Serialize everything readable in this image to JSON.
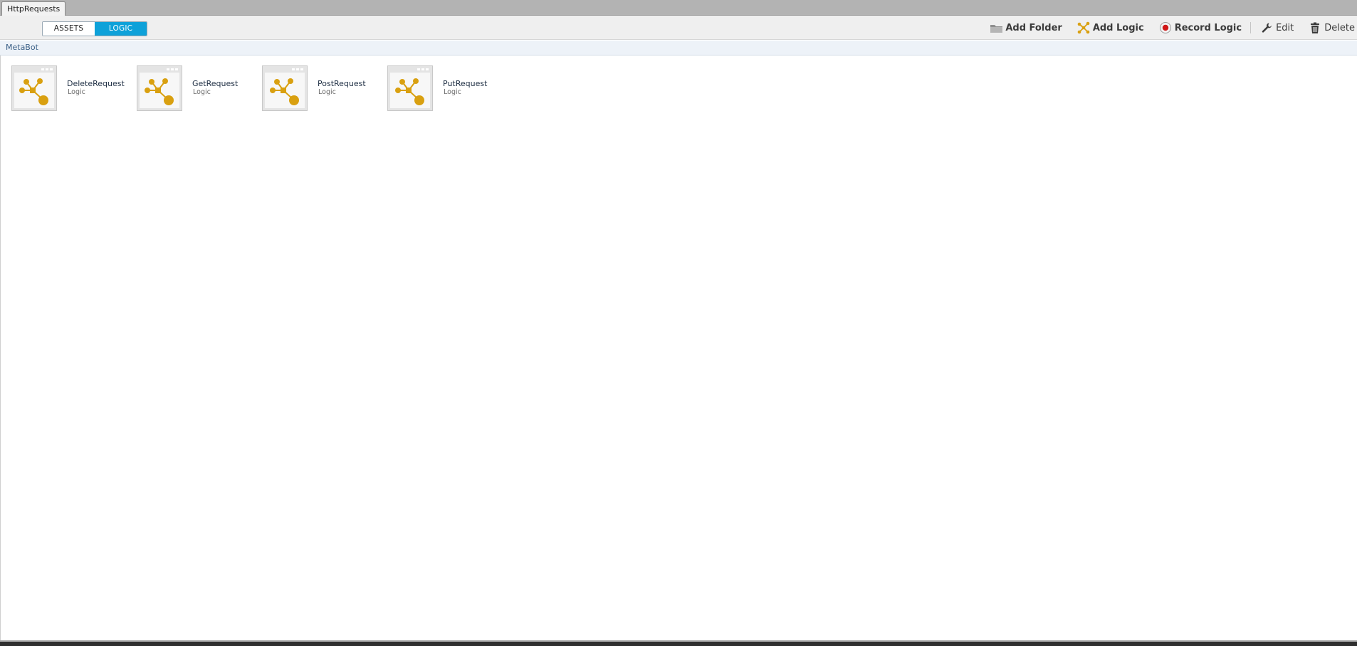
{
  "window": {
    "tab_label": "HttpRequests"
  },
  "toolbar": {
    "segments": [
      {
        "label": "ASSETS",
        "active": false
      },
      {
        "label": "LOGIC",
        "active": true
      }
    ],
    "actions": {
      "add_folder": {
        "label": "Add Folder",
        "icon": "folder-icon"
      },
      "add_logic": {
        "label": "Add Logic",
        "icon": "logic-nodes-icon"
      },
      "record_logic": {
        "label": "Record Logic",
        "icon": "record-icon"
      },
      "edit": {
        "label": "Edit",
        "icon": "wrench-icon"
      },
      "delete": {
        "label": "Delete",
        "icon": "trash-icon"
      }
    }
  },
  "breadcrumb": {
    "label": "MetaBot"
  },
  "items": [
    {
      "name": "DeleteRequest",
      "type": "Logic"
    },
    {
      "name": "GetRequest",
      "type": "Logic"
    },
    {
      "name": "PostRequest",
      "type": "Logic"
    },
    {
      "name": "PutRequest",
      "type": "Logic"
    }
  ],
  "colors": {
    "accent": "#0ea1d9",
    "logic_icon": "#d9a010",
    "record": "#d01818"
  }
}
